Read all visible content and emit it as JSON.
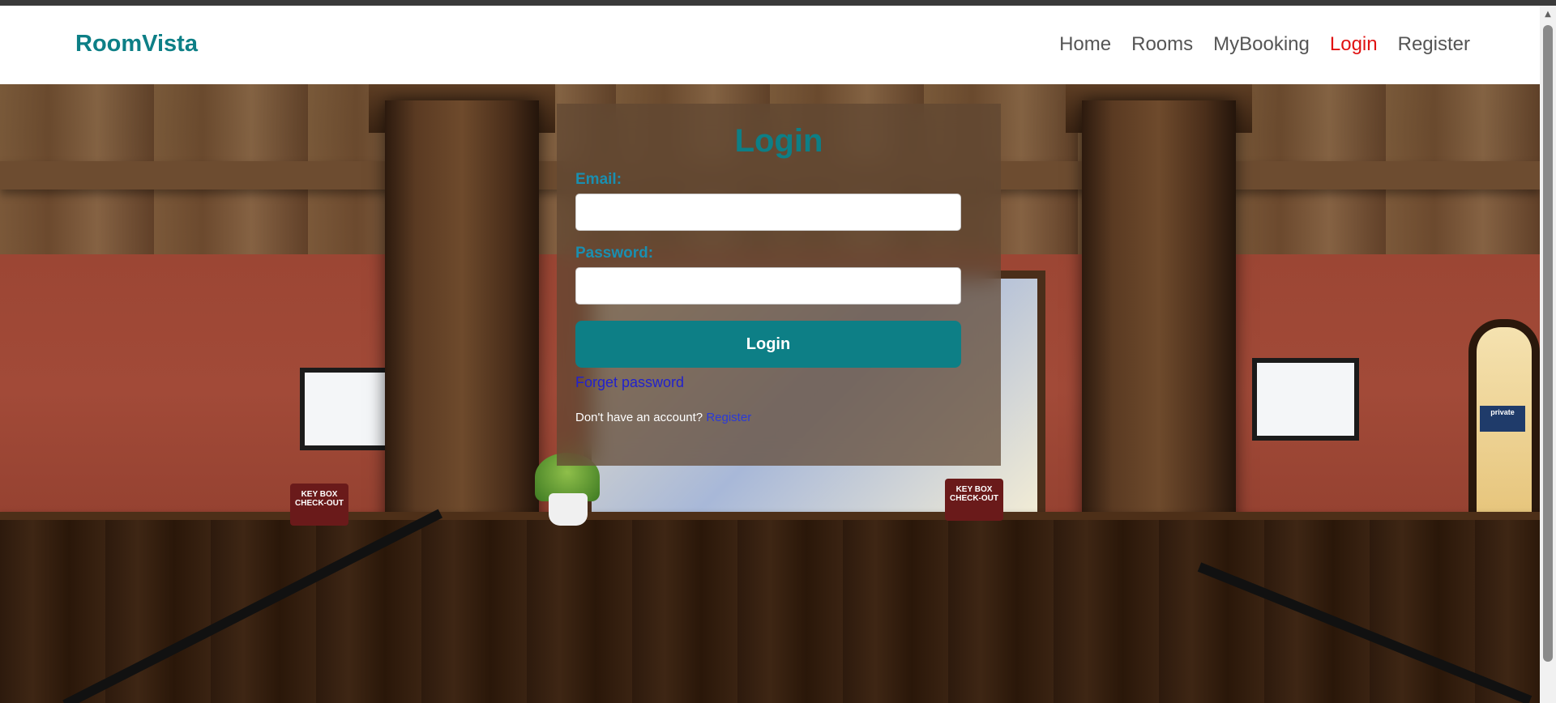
{
  "navbar": {
    "brand": "RoomVista",
    "links": [
      {
        "label": "Home",
        "active": false
      },
      {
        "label": "Rooms",
        "active": false
      },
      {
        "label": "MyBooking",
        "active": false
      },
      {
        "label": "Login",
        "active": true
      },
      {
        "label": "Register",
        "active": false
      }
    ]
  },
  "login_form": {
    "title": "Login",
    "email_label": "Email:",
    "email_value": "",
    "password_label": "Password:",
    "password_value": "",
    "submit_label": "Login",
    "forgot_password": "Forget password",
    "no_account_text": "Don't have an account?",
    "register_link": "Register"
  },
  "background": {
    "sign_left": "KEY BOX\nCHECK-OUT",
    "sign_right": "KEY BOX\nCHECK-OUT",
    "door_sign": "private"
  },
  "colors": {
    "brand": "#0d7f86",
    "active_link": "#e01212",
    "nav_link": "#555555",
    "button": "#0d7f86",
    "label": "#1a8fb0",
    "link": "#2222cc"
  }
}
